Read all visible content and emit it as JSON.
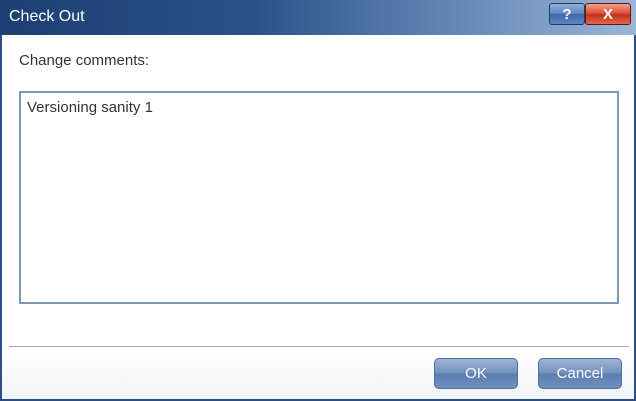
{
  "window": {
    "title": "Check Out",
    "help_label": "?",
    "close_label": "X"
  },
  "form": {
    "comments_label": "Change comments:",
    "comments_value": "Versioning sanity 1"
  },
  "footer": {
    "ok_label": "OK",
    "cancel_label": "Cancel"
  }
}
